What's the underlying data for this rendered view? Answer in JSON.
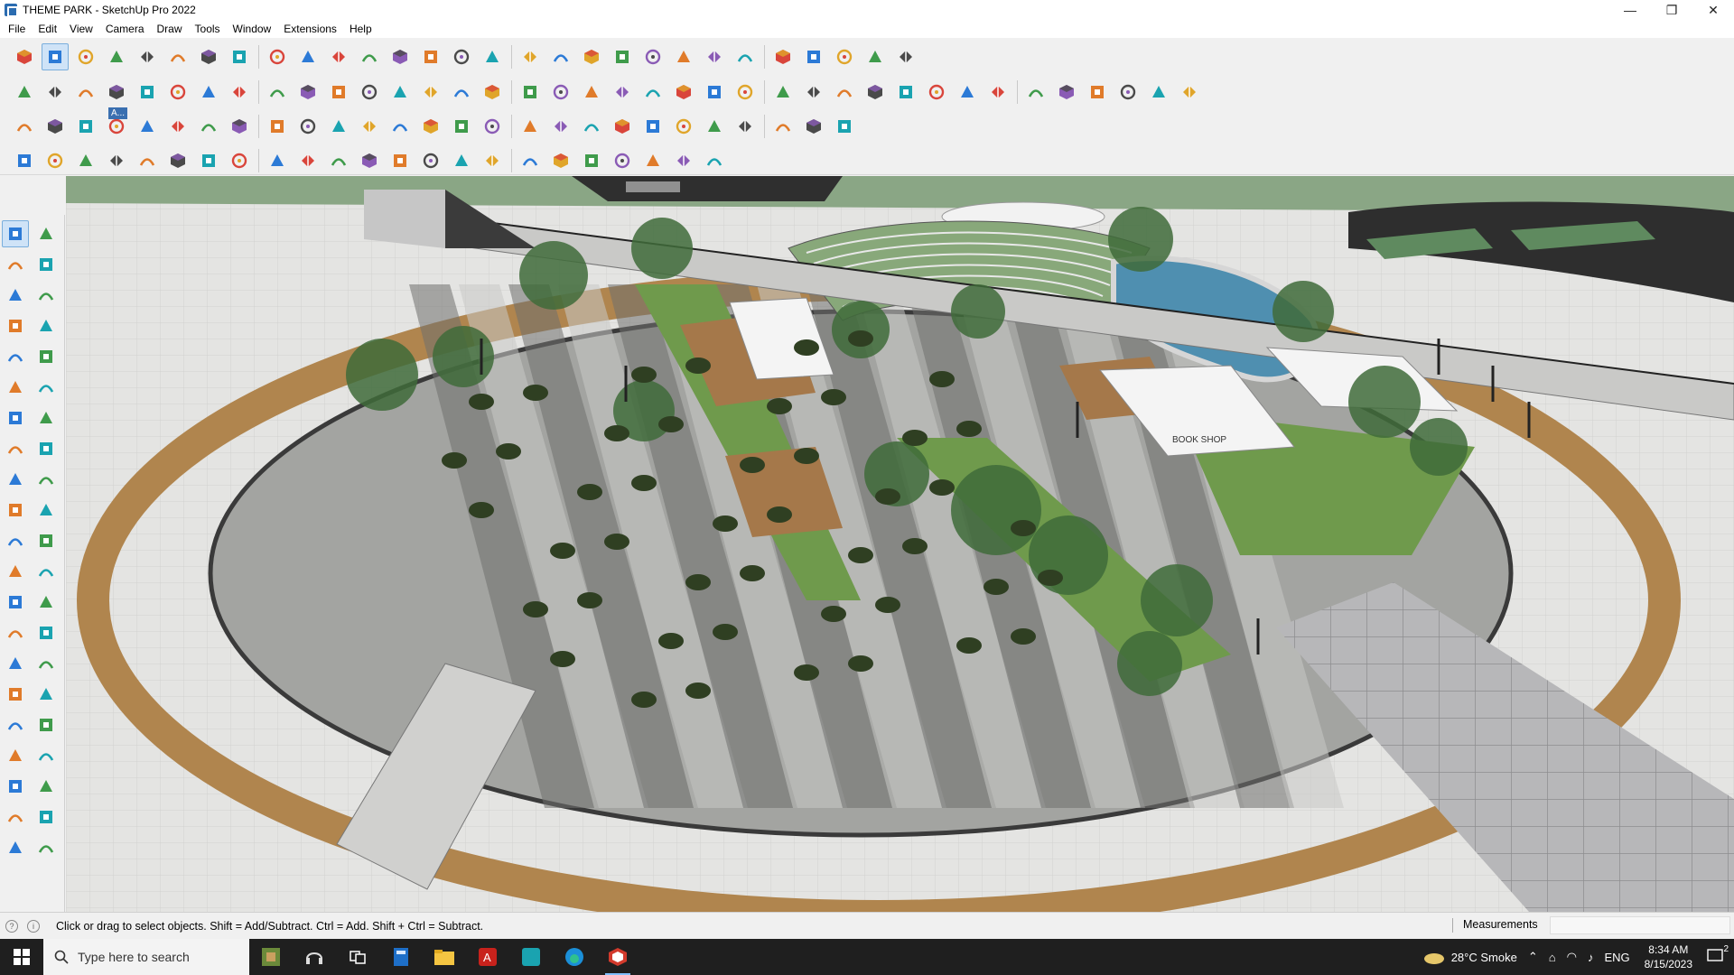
{
  "window": {
    "title": "THEME PARK - SketchUp Pro 2022",
    "controls": [
      "—",
      "❐",
      "✕"
    ]
  },
  "menu": [
    "File",
    "Edit",
    "View",
    "Camera",
    "Draw",
    "Tools",
    "Window",
    "Extensions",
    "Help"
  ],
  "toolbar_rows": [
    [
      "zoom-extents",
      "select",
      "eraser",
      "pencil-line",
      "arc",
      "rectangle",
      "push-pull",
      "follow-me",
      "move",
      "rotate",
      "scale",
      "tape-measure",
      "text",
      "paint-bucket",
      "orbit",
      "pan",
      "zoom",
      "zoom-window",
      "section",
      "styles",
      "layers",
      "scenes",
      "components",
      "materials",
      "axes",
      "outliner",
      "undo",
      "redo",
      "model-info"
    ],
    [
      "iso-view",
      "top-view",
      "front-view",
      "right-view",
      "back-view",
      "left-view",
      "bottom-view",
      "x-ray",
      "wireframe",
      "hidden-line",
      "shaded",
      "textured",
      "monochrome",
      "solid-tools",
      "union",
      "subtract",
      "intersect",
      "sandbox",
      "smoove",
      "stamp",
      "drape",
      "add-detail",
      "flip-edge",
      "warehouse",
      "extension-store",
      "shadows",
      "fog",
      "soften",
      "polygon",
      "circle",
      "ellipse",
      "curve",
      "spline",
      "bezier",
      "offset",
      "weld",
      "extrude",
      "loft"
    ],
    [
      "plane-blue",
      "plane-cyan",
      "plane-yellow",
      "label-tag",
      "sphere",
      "cube-red",
      "cylinder",
      "arc-tool",
      "curve-tool",
      "path",
      "cross",
      "grid",
      "pyramid",
      "cone",
      "spiral",
      "helix",
      "torus",
      "prism",
      "frame",
      "window",
      "door",
      "stairs",
      "railing",
      "column",
      "beam",
      "roof",
      "wall"
    ],
    [
      "polyline",
      "freehand",
      "nurbs",
      "fillet",
      "chamfer",
      "bend",
      "twist",
      "taper",
      "shell",
      "array",
      "mirror",
      "align",
      "distribute",
      "snap",
      "measure",
      "angle",
      "area",
      "volume",
      "export",
      "render",
      "light",
      "camera",
      "animate"
    ]
  ],
  "tooltip_label": "A...",
  "palette": [
    "select-icon",
    "orbit-icon",
    "paint-bucket-icon",
    "eraser-icon",
    "component-icon",
    "tag-icon",
    "line-icon",
    "freehand-icon",
    "rectangle-icon",
    "rotated-rect-icon",
    "circle-icon",
    "polygon-icon",
    "arc-icon",
    "pie-icon",
    "arc2-icon",
    "arc3-icon",
    "move-icon",
    "push-pull-icon",
    "rotate-icon",
    "follow-me-icon",
    "scale-icon",
    "offset-icon",
    "tape-icon",
    "text-icon",
    "protractor-icon",
    "dimension-icon",
    "axes-icon",
    "3dtext-icon",
    "orbit2-icon",
    "pan-icon",
    "zoom-icon",
    "zoom-window-icon",
    "zoom-extents-icon",
    "previous-icon",
    "walk-icon",
    "look-around-icon",
    "position-camera-icon",
    "section-plane-icon",
    "styles-icon",
    "fog-icon",
    "layers-icon",
    "shadows-icon"
  ],
  "status": {
    "hint": "Click or drag to select objects. Shift = Add/Subtract. Ctrl = Add. Shift + Ctrl = Subtract.",
    "measurements_label": "Measurements",
    "measurements_value": ""
  },
  "taskbar": {
    "search_placeholder": "Type here to search",
    "weather": "28°C  Smoke",
    "language": "ENG",
    "time": "8:34 AM",
    "date": "8/15/2023",
    "notification_count": "2"
  },
  "model_sign_text": "BOOK SHOP",
  "colors": {
    "plaza": "#9a9b98",
    "stripe_dark": "#6f706d",
    "stripe_light": "#c8c9c6",
    "grass": "#6f9a4c",
    "wood": "#a5784a",
    "water": "#4f8fb0",
    "tree": "#3f6b3a",
    "umbrella": "#2f3f22",
    "road": "#3a3a3a"
  }
}
